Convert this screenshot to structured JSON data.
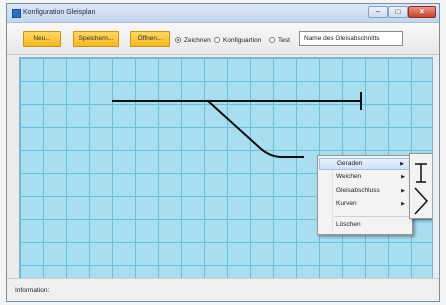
{
  "window": {
    "title": "Konfiguration Gleisplan"
  },
  "toolbar": {
    "new_label": "Neu...",
    "save_label": "Speichern...",
    "open_label": "Öffnen...",
    "mode_options": [
      "Zeichnen",
      "Konfiguartion",
      "Test"
    ],
    "selected_mode": "Zeichnen",
    "name_input": {
      "value": "Name des Gleisabschnitts",
      "placeholder": ""
    }
  },
  "context_menu": {
    "items": [
      {
        "label": "Geraden",
        "has_submenu": true,
        "highlighted": true
      },
      {
        "label": "Weichen",
        "has_submenu": true
      },
      {
        "label": "Gleisabschluss",
        "has_submenu": true
      },
      {
        "label": "Kurven",
        "has_submenu": true
      },
      {
        "label": "Löschen",
        "has_submenu": false
      }
    ],
    "submenu_icons": [
      "straight-vertical-track-icon",
      "diagonal-track-icon"
    ]
  },
  "statusbar": {
    "label": "Information:"
  },
  "colors": {
    "canvas_bg": "#a9ddf0",
    "grid": "#6cbfdc",
    "track": "#111111",
    "button_accent": "#f4b824"
  }
}
